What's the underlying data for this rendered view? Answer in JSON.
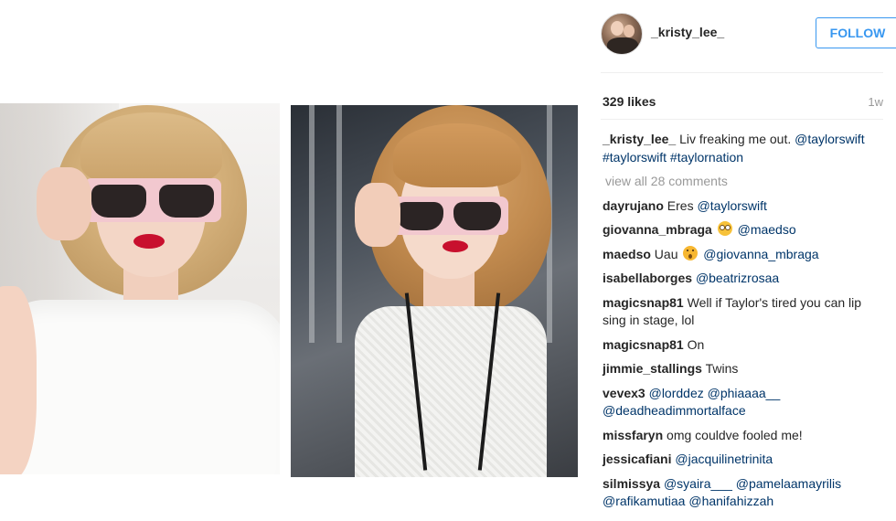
{
  "post": {
    "author": "_kristy_lee_",
    "follow_label": "FOLLOW",
    "likes": "329 likes",
    "time_ago": "1w",
    "caption": {
      "user": "_kristy_lee_",
      "text": " Liv freaking me out. ",
      "tags": "@taylorswift #taylorswift #taylornation"
    },
    "view_all": "view all 28 comments",
    "comments": [
      {
        "user": "dayrujano",
        "text": " Eres ",
        "mention": "@taylorswift"
      },
      {
        "user": "giovanna_mbraga",
        "text": " ",
        "emoji": "flushed-face-emoji",
        "mention": " @maedso"
      },
      {
        "user": "maedso",
        "text": " Uau ",
        "emoji": "open-mouth-face-emoji",
        "mention": " @giovanna_mbraga"
      },
      {
        "user": "isabellaborges",
        "text": " ",
        "mention": "@beatrizrosaa"
      },
      {
        "user": "magicsnap81",
        "text": " Well if Taylor's tired you can lip sing in stage, lol",
        "mention": ""
      },
      {
        "user": "magicsnap81",
        "text": " On",
        "mention": ""
      },
      {
        "user": "jimmie_stallings",
        "text": " Twins",
        "mention": ""
      },
      {
        "user": "vevex3",
        "text": " ",
        "mention": "@lorddez @phiaaaa__ @deadheadimmortalface"
      },
      {
        "user": "missfaryn",
        "text": " omg couldve fooled me!",
        "mention": ""
      },
      {
        "user": "jessicafiani",
        "text": " ",
        "mention": "@jacquilinetrinita"
      },
      {
        "user": "silmissya",
        "text": " ",
        "mention": "@syaira___ @pamelaamayrilis @rafikamutiaa @hanifahizzah"
      }
    ]
  },
  "colors": {
    "accent": "#3897f0",
    "mention": "#003569",
    "muted": "#999999",
    "lipstick": "#c8102e",
    "glasses_frame": "#f2c8cf"
  }
}
